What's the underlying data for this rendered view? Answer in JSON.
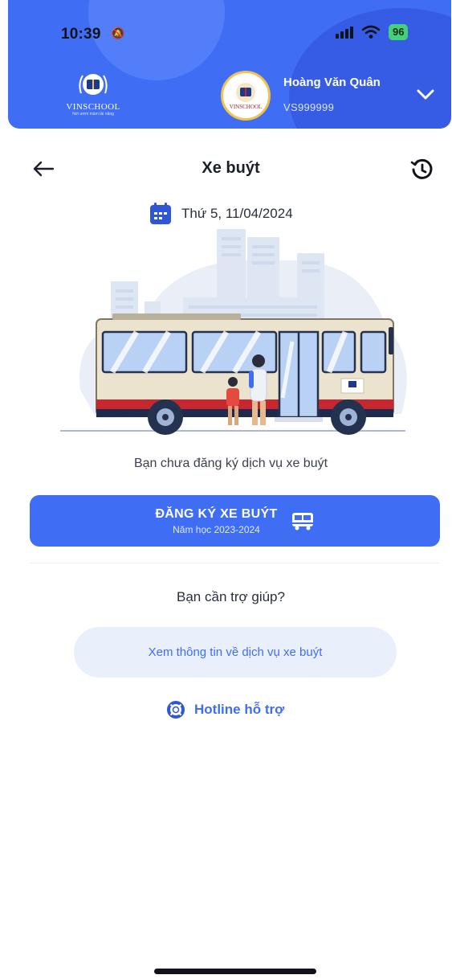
{
  "status_bar": {
    "time": "10:39",
    "battery": "96"
  },
  "header": {
    "school_name": "VINSCHOOL",
    "school_tagline": "Nơi ươm mầm tài năng",
    "avatar_label": "VINSCHOOL",
    "user_name": "Hoàng Văn Quân",
    "user_code": "VS999999"
  },
  "nav": {
    "title": "Xe buýt"
  },
  "date": "Thứ 5, 11/04/2024",
  "empty_message": "Bạn chưa đăng ký dịch vụ xe buýt",
  "register_button": {
    "title": "ĐĂNG KÝ XE BUÝT",
    "subtitle": "Năm học 2023-2024"
  },
  "help": {
    "title": "Bạn cần trợ giúp?",
    "info_button": "Xem thông tin về dịch vụ xe buýt",
    "hotline": "Hotline hỗ trợ"
  },
  "colors": {
    "primary": "#3f6ef5",
    "info_bg": "#eaf0fb",
    "bus_body": "#ece3cf",
    "bus_stripe": "#c9272f"
  },
  "icons": [
    "mute-icon",
    "signal-icon",
    "wifi-icon",
    "chevron-down-icon",
    "back-arrow-icon",
    "history-icon",
    "calendar-icon",
    "bus-icon",
    "lifebuoy-icon"
  ]
}
